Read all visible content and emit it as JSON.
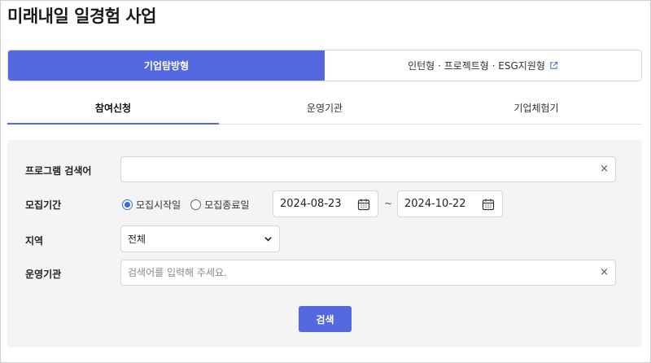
{
  "page": {
    "title": "미래내일 일경험 사업"
  },
  "main_tabs": [
    {
      "label": "기업탐방형",
      "active": true
    },
    {
      "label": "인턴형 · 프로젝트형 · ESG지원형",
      "active": false,
      "icon": "external-link-icon"
    }
  ],
  "sub_tabs": [
    {
      "label": "참여신청",
      "active": true
    },
    {
      "label": "운영기관",
      "active": false
    },
    {
      "label": "기업체험기",
      "active": false
    }
  ],
  "form": {
    "program_search": {
      "label": "프로그램 검색어",
      "value": "",
      "placeholder": ""
    },
    "recruit_period": {
      "label": "모집기간",
      "options": [
        {
          "label": "모집시작일",
          "checked": true
        },
        {
          "label": "모집종료일",
          "checked": false
        }
      ],
      "start_date": "2024-08-23",
      "separator": "~",
      "end_date": "2024-10-22"
    },
    "region": {
      "label": "지역",
      "selected": "전체"
    },
    "operator": {
      "label": "운영기관",
      "value": "",
      "placeholder": "검색어를 입력해 주세요."
    },
    "clear_symbol": "×",
    "search_button": "검색"
  },
  "colors": {
    "accent": "#5468e0",
    "radio": "#2f6fe0",
    "panel_bg": "#f4f4f4"
  }
}
